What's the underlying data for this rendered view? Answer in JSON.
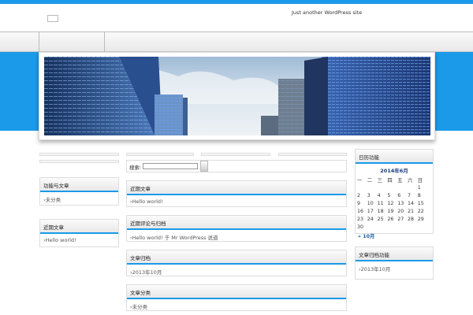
{
  "site": {
    "tagline": "Just another WordPress site"
  },
  "colors": {
    "accent": "#1a9ae8",
    "header_bg": "#ffffff"
  },
  "search": {
    "label": "搜索:",
    "value": "",
    "button": ""
  },
  "left_sidebar": [
    {
      "title": "功能与文章",
      "items": [
        "未分类"
      ]
    },
    {
      "title": "近期文章",
      "items": [
        "Hello world!"
      ]
    }
  ],
  "center_widgets": [
    {
      "title": "近期文章",
      "items": [
        "Hello world!"
      ]
    },
    {
      "title": "近期评论与归档",
      "items": [
        "Hello world! 于 Mr WordPress 说道"
      ]
    },
    {
      "title": "文章归档",
      "items": [
        "2013年10月"
      ]
    },
    {
      "title": "文章分类",
      "items": [
        "未分类"
      ]
    }
  ],
  "calendar": {
    "title": "日历功能",
    "month_label": "2014年6月",
    "weekdays": [
      "一",
      "二",
      "三",
      "四",
      "五",
      "六",
      "日"
    ],
    "rows": [
      [
        "",
        "",
        "",
        "",
        "",
        "",
        "1"
      ],
      [
        "2",
        "3",
        "4",
        "5",
        "6",
        "7",
        "8"
      ],
      [
        "9",
        "10",
        "11",
        "12",
        "13",
        "14",
        "15"
      ],
      [
        "16",
        "17",
        "18",
        "19",
        "20",
        "21",
        "22"
      ],
      [
        "23",
        "24",
        "25",
        "26",
        "27",
        "28",
        "29"
      ],
      [
        "30",
        "",
        "",
        "",
        "",
        "",
        ""
      ]
    ],
    "prev_link": "« 10月"
  },
  "right_archive": {
    "title": "文章归档功能",
    "items": [
      "2013年10月"
    ]
  }
}
